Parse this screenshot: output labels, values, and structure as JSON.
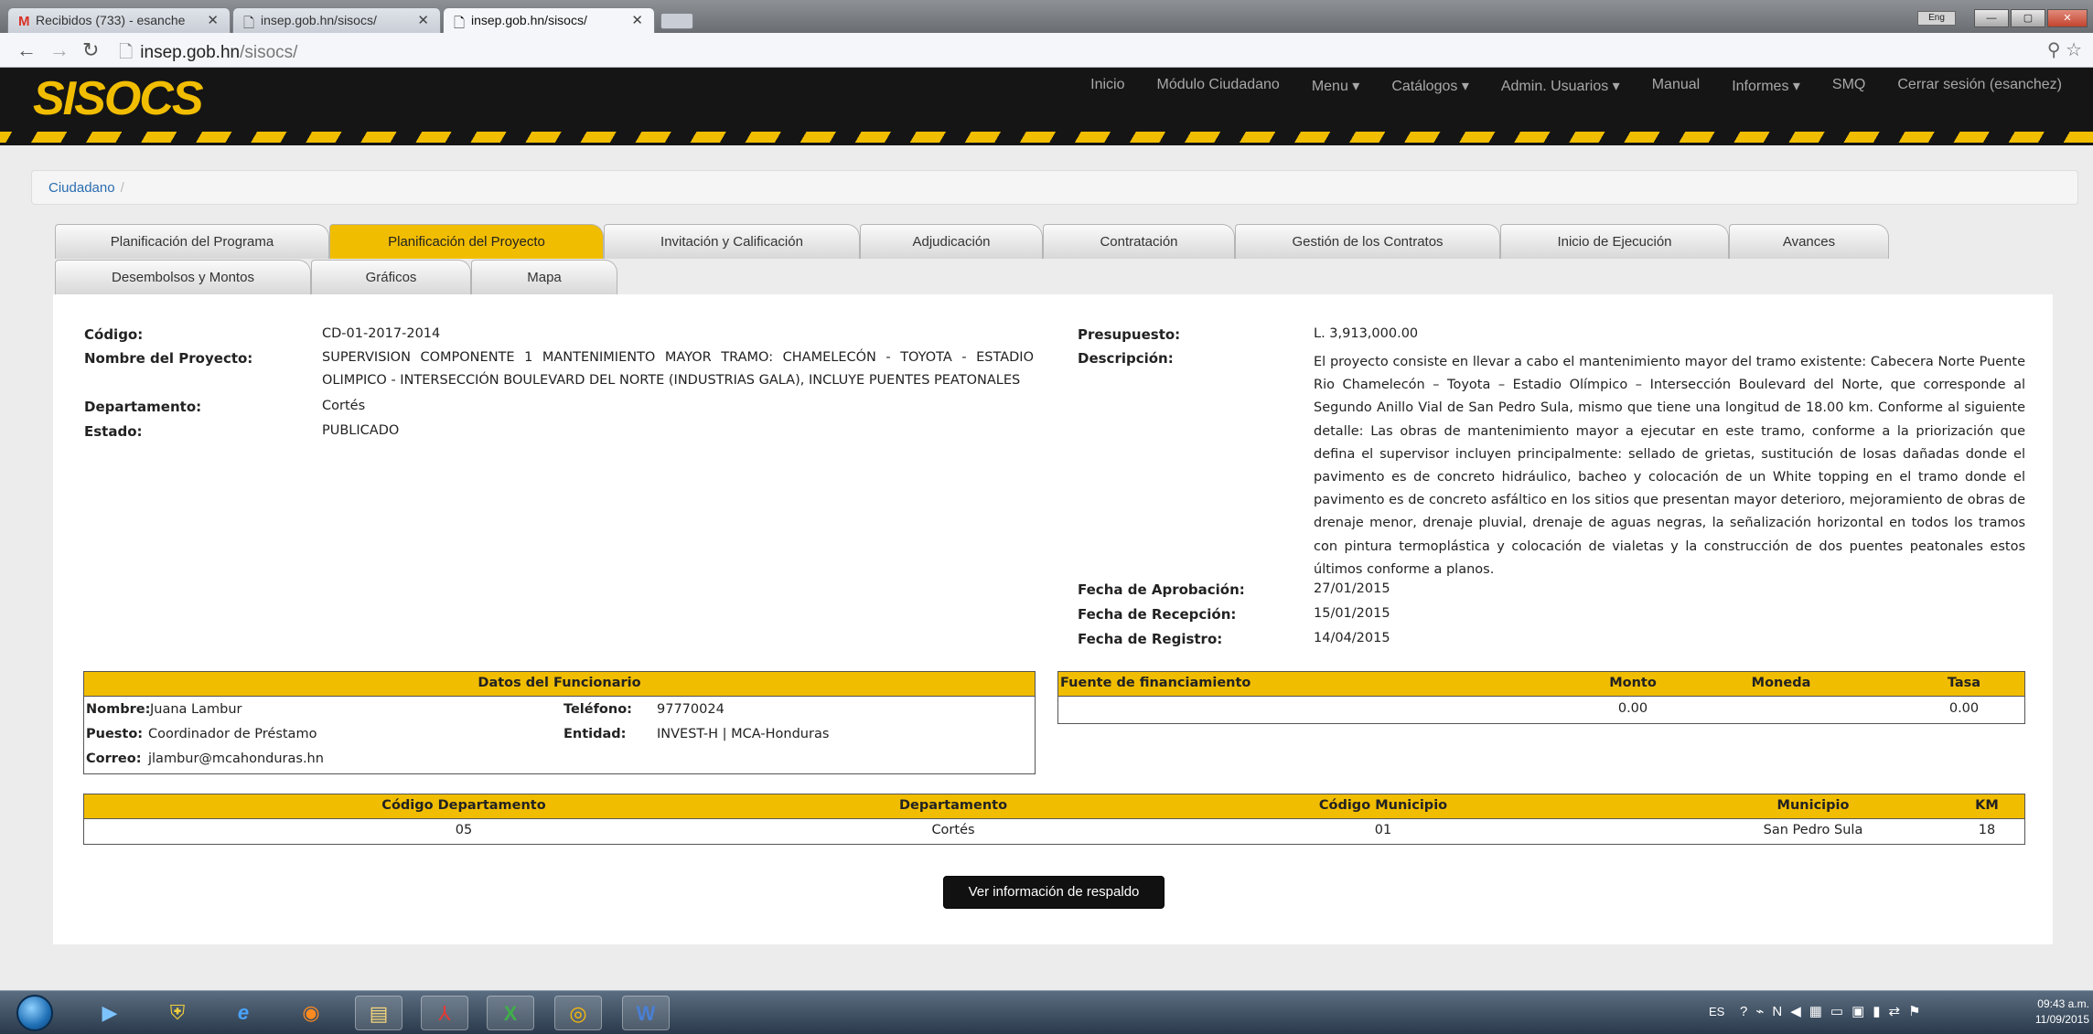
{
  "browser": {
    "tabs": [
      {
        "title": "Recibidos (733) - esanche",
        "icon": "gmail-icon"
      },
      {
        "title": "insep.gob.hn/sisocs/",
        "icon": "page-icon"
      },
      {
        "title": "insep.gob.hn/sisocs/",
        "icon": "page-icon"
      }
    ],
    "url_host": "insep.gob.hn",
    "url_path": "/sisocs/",
    "lang_badge": "Eng"
  },
  "site": {
    "logo": "SISOCS",
    "nav": [
      "Inicio",
      "Módulo Ciudadano",
      "Menu ▾",
      "Catálogos ▾",
      "Admin. Usuarios ▾",
      "Manual",
      "Informes ▾",
      "SMQ",
      "Cerrar sesión (esanchez)"
    ]
  },
  "breadcrumb": {
    "item": "Ciudadano",
    "separator": "/"
  },
  "tabs_row1": [
    "Planificación del Programa",
    "Planificación del Proyecto",
    "Invitación y Calificación",
    "Adjudicación",
    "Contratación",
    "Gestión de los Contratos",
    "Inicio de Ejecución",
    "Avances"
  ],
  "tabs_row2": [
    "Desembolsos y Montos",
    "Gráficos",
    "Mapa"
  ],
  "project": {
    "codigo_label": "Código:",
    "codigo": "CD-01-2017-2014",
    "nombre_label": "Nombre del Proyecto:",
    "nombre_line1": "SUPERVISION COMPONENTE 1 MANTENIMIENTO MAYOR TRAMO: CHAMELECÓN - TOYOTA - ESTADIO",
    "nombre_line2": "OLIMPICO - INTERSECCIÓN BOULEVARD DEL NORTE (INDUSTRIAS GALA), INCLUYE PUENTES PEATONALES",
    "departamento_label": "Departamento:",
    "departamento": "Cortés",
    "estado_label": "Estado:",
    "estado": "PUBLICADO",
    "presupuesto_label": "Presupuesto:",
    "presupuesto": "L. 3,913,000.00",
    "descripcion_label": "Descripción:",
    "descripcion": "El proyecto consiste en llevar a cabo el mantenimiento mayor del tramo existente: Cabecera Norte Puente Rio Chamelecón – Toyota – Estadio Olímpico – Intersección Boulevard del Norte, que corresponde al Segundo Anillo Vial de San Pedro Sula, mismo que tiene una longitud de 18.00 km. Conforme al siguiente detalle: Las obras de mantenimiento mayor a ejecutar en este tramo, conforme a la priorización que defina el supervisor incluyen principalmente: sellado de grietas, sustitución de losas dañadas donde el pavimento es de concreto hidráulico, bacheo y colocación de un White topping en el tramo donde el pavimento es de concreto asfáltico en los sitios que presentan mayor deterioro, mejoramiento de obras de drenaje menor, drenaje pluvial, drenaje de aguas negras, la señalización horizontal en todos los tramos con pintura termoplástica y colocación de vialetas y la construcción de dos puentes peatonales estos últimos conforme a planos.",
    "fecha_aprobacion_label": "Fecha de Aprobación:",
    "fecha_aprobacion": "27/01/2015",
    "fecha_recepcion_label": "Fecha de Recepción:",
    "fecha_recepcion": "15/01/2015",
    "fecha_registro_label": "Fecha de Registro:",
    "fecha_registro": "14/04/2015"
  },
  "funcionario": {
    "header": "Datos del Funcionario",
    "nombre_label": "Nombre:",
    "nombre": "Juana Lambur",
    "telefono_label": "Teléfono:",
    "telefono": "97770024",
    "puesto_label": "Puesto:",
    "puesto": "Coordinador de Préstamo",
    "entidad_label": "Entidad:",
    "entidad": "INVEST-H | MCA-Honduras",
    "correo_label": "Correo:",
    "correo": "jlambur@mcahonduras.hn"
  },
  "financiamiento": {
    "headers": [
      "Fuente de financiamiento",
      "Monto",
      "Moneda",
      "Tasa"
    ],
    "row": [
      "",
      "0.00",
      "",
      "0.00"
    ]
  },
  "ubicacion": {
    "headers": [
      "Código Departamento",
      "Departamento",
      "Código Municipio",
      "Municipio",
      "KM"
    ],
    "row": [
      "05",
      "Cortés",
      "01",
      "San Pedro Sula",
      "18"
    ]
  },
  "respaldo_button": "Ver información de respaldo",
  "taskbar": {
    "lang": "ES",
    "time": "09:43 a.m.",
    "date": "11/09/2015"
  }
}
